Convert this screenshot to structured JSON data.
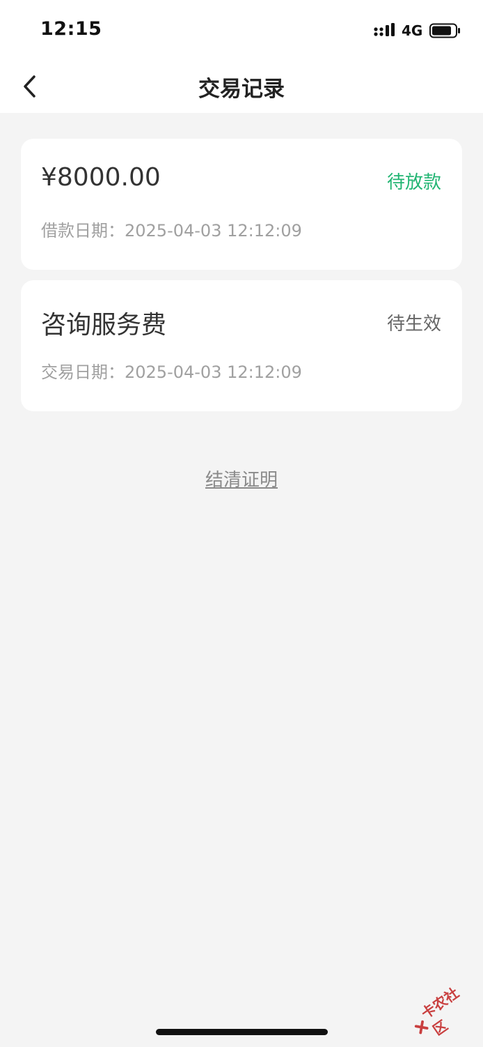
{
  "status_bar": {
    "time": "12:15",
    "network": "4G",
    "icons": [
      "signal-icon",
      "battery-icon"
    ]
  },
  "nav": {
    "title": "交易记录",
    "back_icon": "chevron-left-icon"
  },
  "records": [
    {
      "main": "¥8000.00",
      "status": "待放款",
      "date": "借款日期：2025-04-03 12:12:09",
      "status_color": "#22b573"
    },
    {
      "main": "咨询服务费",
      "status": "待生效",
      "date": "交易日期：2025-04-03 12:12:09",
      "status_color": "#666666"
    }
  ],
  "settle_link": "结清证明",
  "watermark": "卡农社区",
  "colors": {
    "background": "#f4f4f4",
    "card": "#ffffff",
    "accent_green": "#22b573"
  }
}
